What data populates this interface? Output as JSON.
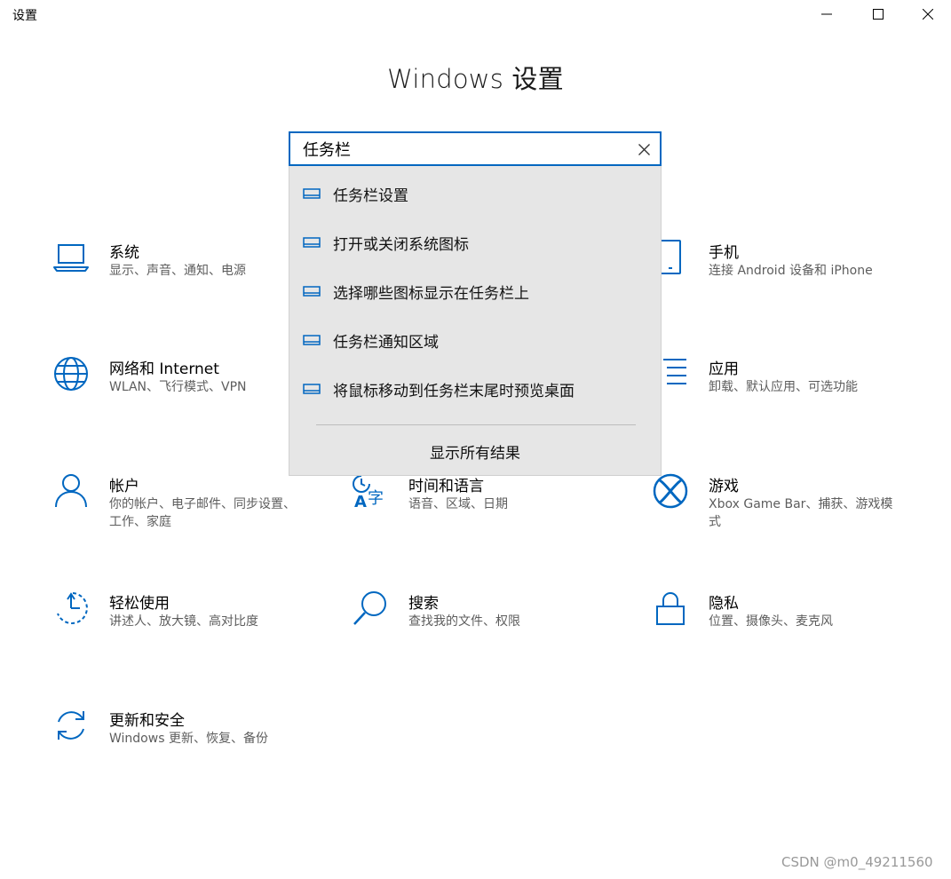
{
  "window": {
    "title": "设置",
    "minimize_glyph": "—",
    "maximize_glyph": "☐",
    "close_glyph": "✕"
  },
  "page_title": "Windows 设置",
  "search": {
    "value": "任务栏",
    "clear_icon": "close-icon"
  },
  "suggestions": [
    {
      "label": "任务栏设置",
      "icon": "taskbar-icon"
    },
    {
      "label": "打开或关闭系统图标",
      "icon": "taskbar-icon"
    },
    {
      "label": "选择哪些图标显示在任务栏上",
      "icon": "taskbar-icon"
    },
    {
      "label": "任务栏通知区域",
      "icon": "taskbar-icon"
    },
    {
      "label": "将鼠标移动到任务栏末尾时预览桌面",
      "icon": "taskbar-icon"
    }
  ],
  "show_all_results": "显示所有结果",
  "tiles": [
    {
      "title": "系统",
      "subtitle": "显示、声音、通知、电源",
      "icon": "laptop-icon"
    },
    {
      "title": "手机",
      "subtitle": "连接 Android 设备和 iPhone",
      "icon": "phone-icon"
    },
    {
      "title": "网络和 Internet",
      "subtitle": "WLAN、飞行模式、VPN",
      "icon": "globe-icon"
    },
    {
      "title": "应用",
      "subtitle": "卸载、默认应用、可选功能",
      "icon": "apps-list-icon"
    },
    {
      "title": "帐户",
      "subtitle": "你的帐户、电子邮件、同步设置、工作、家庭",
      "icon": "person-icon"
    },
    {
      "title": "时间和语言",
      "subtitle": "语音、区域、日期",
      "icon": "time-language-icon"
    },
    {
      "title": "游戏",
      "subtitle": "Xbox Game Bar、捕获、游戏模式",
      "icon": "xbox-icon"
    },
    {
      "title": "轻松使用",
      "subtitle": "讲述人、放大镜、高对比度",
      "icon": "ease-of-access-icon"
    },
    {
      "title": "搜索",
      "subtitle": "查找我的文件、权限",
      "icon": "search-icon"
    },
    {
      "title": "隐私",
      "subtitle": "位置、摄像头、麦克风",
      "icon": "lock-icon"
    },
    {
      "title": "更新和安全",
      "subtitle": "Windows 更新、恢复、备份",
      "icon": "update-icon"
    }
  ],
  "watermark": "CSDN @m0_49211560",
  "colors": {
    "accent": "#0067c0",
    "suggest_bg": "#e6e6e6"
  }
}
